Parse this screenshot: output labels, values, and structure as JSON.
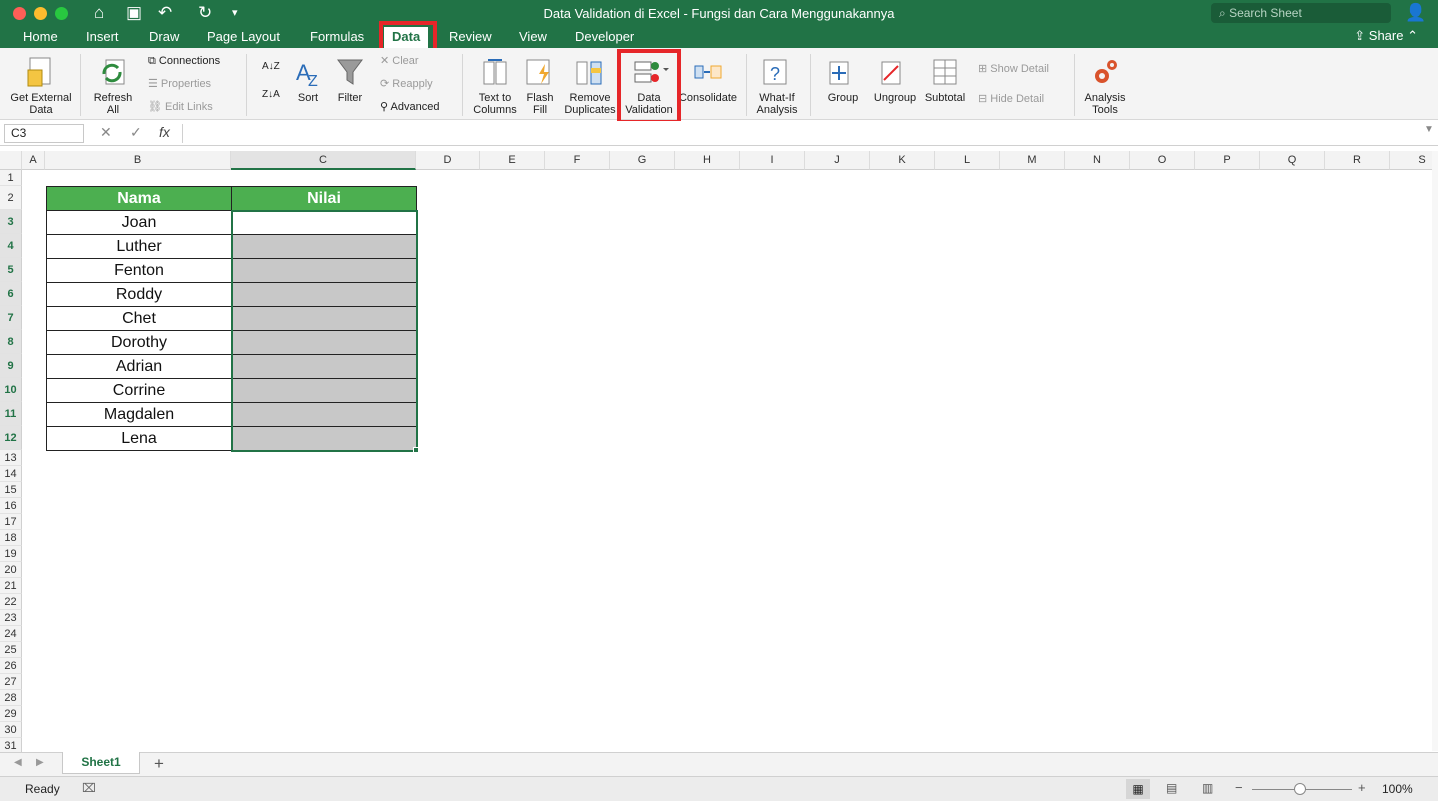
{
  "window": {
    "title": "Data Validation di Excel - Fungsi dan Cara Menggunakannya",
    "search_placeholder": "Search Sheet",
    "share_label": "Share"
  },
  "tabs": [
    "Home",
    "Insert",
    "Draw",
    "Page Layout",
    "Formulas",
    "Data",
    "Review",
    "View",
    "Developer"
  ],
  "active_tab": "Data",
  "ribbon": {
    "get_external_data": "Get External Data",
    "refresh_all": "Refresh All",
    "connections": "Connections",
    "properties": "Properties",
    "edit_links": "Edit Links",
    "sort": "Sort",
    "filter": "Filter",
    "clear": "Clear",
    "reapply": "Reapply",
    "advanced": "Advanced",
    "text_to_columns": "Text to Columns",
    "flash_fill": "Flash Fill",
    "remove_duplicates": "Remove Duplicates",
    "data_validation": "Data Validation",
    "consolidate": "Consolidate",
    "what_if": "What-If Analysis",
    "group": "Group",
    "ungroup": "Ungroup",
    "subtotal": "Subtotal",
    "show_detail": "Show Detail",
    "hide_detail": "Hide Detail",
    "analysis_tools": "Analysis Tools"
  },
  "formula_bar": {
    "name_box": "C3",
    "fx": "fx",
    "formula": ""
  },
  "columns": [
    "A",
    "B",
    "C",
    "D",
    "E",
    "F",
    "G",
    "H",
    "I",
    "J",
    "K",
    "L",
    "M",
    "N",
    "O",
    "P",
    "Q",
    "R",
    "S"
  ],
  "rows": [
    "1",
    "2",
    "3",
    "4",
    "5",
    "6",
    "7",
    "8",
    "9",
    "10",
    "11",
    "12",
    "13",
    "14",
    "15",
    "16",
    "17",
    "18",
    "19",
    "20",
    "21",
    "22",
    "23",
    "24",
    "25",
    "26",
    "27",
    "28",
    "29",
    "30",
    "31"
  ],
  "table": {
    "headers": [
      "Nama",
      "Nilai"
    ],
    "names": [
      "Joan",
      "Luther",
      "Fenton",
      "Roddy",
      "Chet",
      "Dorothy",
      "Adrian",
      "Corrine",
      "Magdalen",
      "Lena"
    ]
  },
  "sheet_tabs": [
    "Sheet1"
  ],
  "add_sheet": "+",
  "status": {
    "ready": "Ready",
    "zoom": "100%"
  },
  "colors": {
    "excel_green": "#217346",
    "header_green": "#4caf50",
    "highlight_red": "#e62629",
    "cell_gray": "#c8c8c8"
  }
}
